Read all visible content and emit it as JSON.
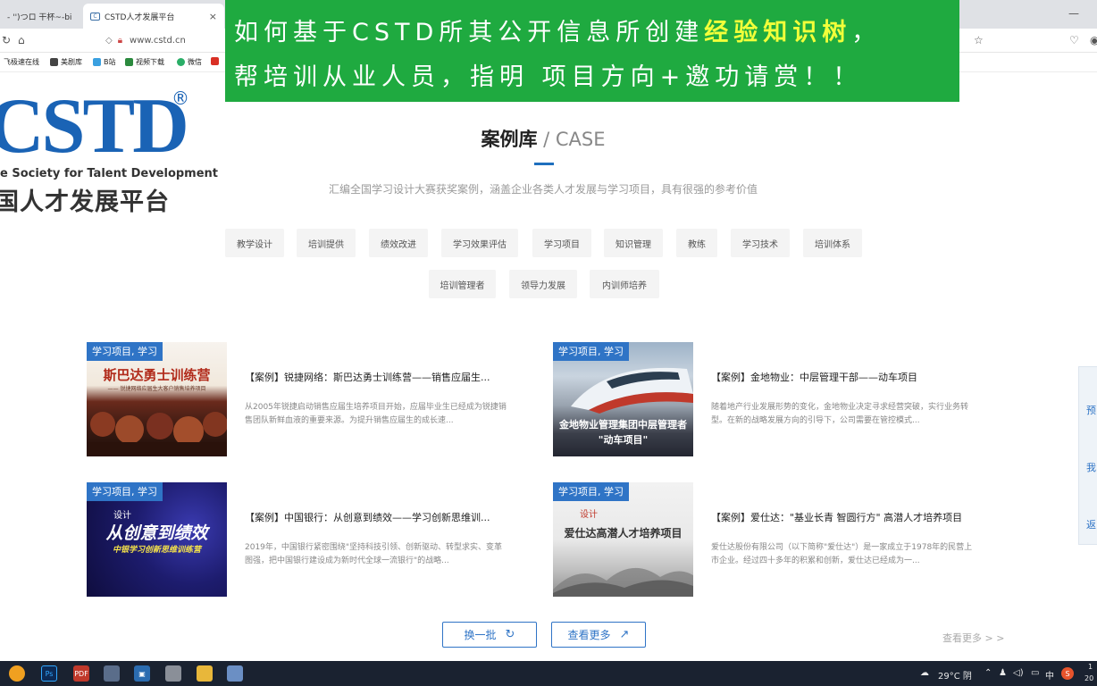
{
  "browser": {
    "tabs": [
      {
        "label": "-  '')つロ 干杯~-bi"
      },
      {
        "label": "CSTD人才发展平台",
        "close": "×"
      }
    ],
    "url": "www.cstd.cn",
    "bookmarks": [
      {
        "label": "飞极速在线",
        "color": "#3a9a3a"
      },
      {
        "label": "美剧库",
        "color": "#444"
      },
      {
        "label": "B站",
        "color": "#3aa0e0"
      },
      {
        "label": "视频下载",
        "color": "#2b8a3e"
      },
      {
        "label": "微信",
        "color": "#2aae67"
      }
    ]
  },
  "logo": {
    "mark": "CSTD",
    "registered": "®",
    "tagline": "e Society for Talent Development",
    "name": "国人才发展平台"
  },
  "banner": {
    "line1_prefix": "如何基于CSTD所其公开信息所创建",
    "line1_highlight": "经验知识树",
    "line1_suffix": "，",
    "line2": "帮培训从业人员，指明 项目方向+邀功请赏！！"
  },
  "section": {
    "title_cn": "案例库",
    "title_en": " / CASE",
    "description": "汇编全国学习设计大赛获奖案例，涵盖企业各类人才发展与学习项目，具有很强的参考价值"
  },
  "tags_row1": [
    "教学设计",
    "培训提供",
    "绩效改进",
    "学习效果评估",
    "学习项目",
    "知识管理",
    "教练",
    "学习技术",
    "培训体系"
  ],
  "tags_row2": [
    "培训管理者",
    "领导力发展",
    "内训师培养"
  ],
  "cards": [
    {
      "label": "学习项目, 学习",
      "title": "【案例】锐捷网络：斯巴达勇士训练营——销售应届生...",
      "desc": "从2005年锐捷启动销售应届生培养项目开始，应届毕业生已经成为锐捷销售团队新鲜血液的重要来源。为提升销售应届生的成长速...",
      "img_title": "斯巴达勇士训练营",
      "img_sub": "—— 锐捷网络应届生大客户销售培养项目"
    },
    {
      "label": "学习项目, 学习",
      "title": "【案例】金地物业：中层管理干部——动车项目",
      "desc": "随着地产行业发展形势的变化，金地物业决定寻求经营突破，实行业务转型。在新的战略发展方向的引导下，公司需要在管控模式...",
      "img_title": "金地物业管理集团中层管理者",
      "img_sub": "\"动车项目\""
    },
    {
      "label": "学习项目, 学习",
      "title": "【案例】中国银行：从创意到绩效——学习创新思维训...",
      "desc": "2019年，中国银行紧密围绕\"坚持科技引领、创新驱动、转型求实、变革图强，把中国银行建设成为新时代全球一流银行\"的战略...",
      "img_tag": "设计",
      "img_title": "从创意到绩效",
      "img_sub": "中银学习创新思维训练营"
    },
    {
      "label": "学习项目, 学习",
      "title": "【案例】爱仕达：\"基业长青 智圆行方\" 高潜人才培养项目",
      "desc": "爱仕达股份有限公司（以下简称\"爱仕达\"）是一家成立于1978年的民营上市企业。经过四十多年的积累和创新，爱仕达已经成为一...",
      "img_tag": "设计",
      "img_title": "爱仕达高潜人才培养项目"
    }
  ],
  "buttons": {
    "refresh": "换一批",
    "more": "查看更多",
    "more_link": "查看更多 > >"
  },
  "rightbar": [
    "预",
    "我",
    "返"
  ],
  "taskbar": {
    "weather": "29°C 阴",
    "ime": "中",
    "clock": "1",
    "date": "20"
  },
  "colors": {
    "brand_blue": "#1a63b5",
    "accent": "#2f74c6",
    "banner_green": "#1faa40",
    "banner_highlight": "#f2ff3a"
  }
}
